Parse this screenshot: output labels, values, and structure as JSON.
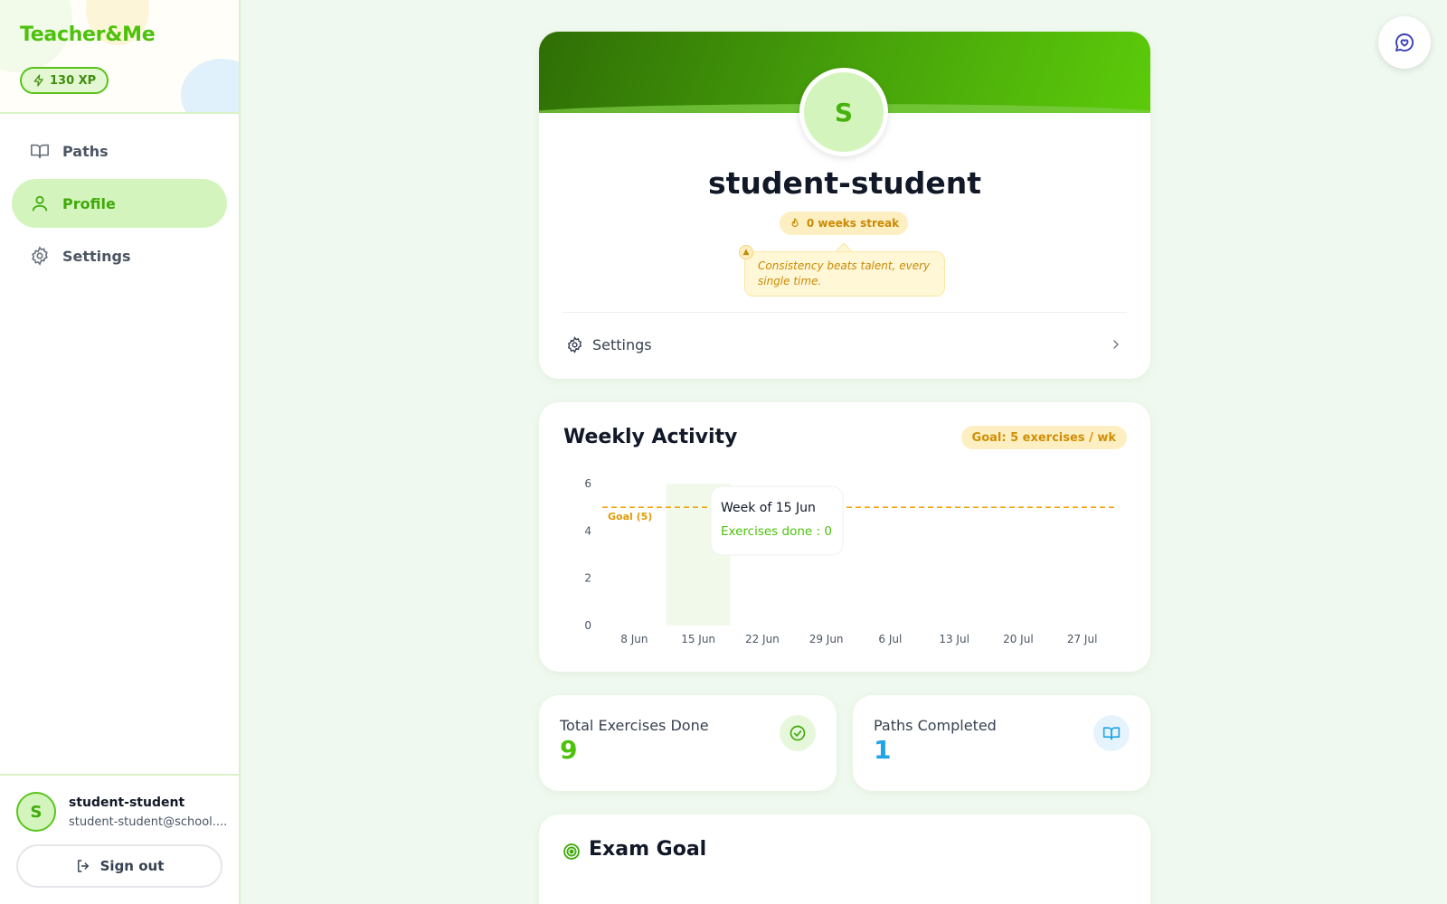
{
  "app": {
    "brand": "Teacher&Me",
    "xp": "130 XP"
  },
  "sidebar": {
    "items": [
      {
        "label": "Paths",
        "icon": "book-icon"
      },
      {
        "label": "Profile",
        "icon": "user-icon"
      },
      {
        "label": "Settings",
        "icon": "gear-icon"
      }
    ],
    "active": "Profile",
    "user": {
      "initial": "S",
      "name": "student-student",
      "email": "student-student@school...."
    },
    "sign_out": "Sign out"
  },
  "profile": {
    "initial": "S",
    "name": "student-student",
    "streak": "0 weeks streak",
    "quote": "Consistency beats talent, every single time.",
    "settings_label": "Settings"
  },
  "activity": {
    "title": "Weekly Activity",
    "goal_badge": "Goal: 5 exercises / wk",
    "goal_line_label": "Goal (5)",
    "tooltip": {
      "title": "Week of 15 Jun",
      "line": "Exercises done : 0"
    }
  },
  "stats": {
    "total": {
      "label": "Total Exercises Done",
      "value": "9"
    },
    "paths": {
      "label": "Paths Completed",
      "value": "1"
    }
  },
  "exam": {
    "title": "Exam Goal"
  },
  "colors": {
    "accent": "#4cc20a",
    "goal": "#f0a40a",
    "paths_blue": "#1fa4e8"
  },
  "chart_data": {
    "type": "bar",
    "categories": [
      "8 Jun",
      "15 Jun",
      "22 Jun",
      "29 Jun",
      "6 Jul",
      "13 Jul",
      "20 Jul",
      "27 Jul"
    ],
    "series": [
      {
        "name": "Exercises done",
        "values": [
          0,
          0,
          0,
          0,
          0,
          0,
          0,
          0
        ]
      }
    ],
    "yticks": [
      0,
      2,
      4,
      6
    ],
    "ylim": [
      0,
      6
    ],
    "goal": 5,
    "highlighted": "15 Jun",
    "title": "Weekly Activity",
    "xlabel": "",
    "ylabel": ""
  }
}
